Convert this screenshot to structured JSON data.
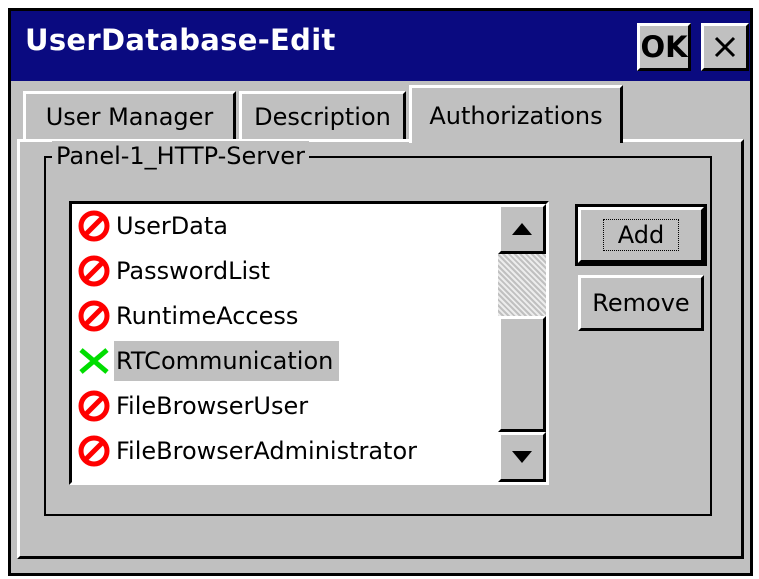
{
  "window": {
    "title": "UserDatabase-Edit",
    "ok_label": "OK",
    "close_icon": "close-icon"
  },
  "tabs": [
    {
      "label": "User Manager",
      "active": false
    },
    {
      "label": "Description",
      "active": false
    },
    {
      "label": "Authorizations",
      "active": true
    }
  ],
  "group": {
    "label": "Panel-1_HTTP-Server"
  },
  "list": {
    "items": [
      {
        "label": "UserData",
        "state": "denied",
        "icon": "prohibited-icon"
      },
      {
        "label": "PasswordList",
        "state": "denied",
        "icon": "prohibited-icon"
      },
      {
        "label": "RuntimeAccess",
        "state": "denied",
        "icon": "prohibited-icon"
      },
      {
        "label": "RTCommunication",
        "state": "granted",
        "icon": "granted-x-icon",
        "selected": true
      },
      {
        "label": "FileBrowserUser",
        "state": "denied",
        "icon": "prohibited-icon"
      },
      {
        "label": "FileBrowserAdministrator",
        "state": "denied",
        "icon": "prohibited-icon"
      }
    ]
  },
  "buttons": {
    "add_label": "Add",
    "remove_label": "Remove"
  },
  "colors": {
    "titlebar": "#0a0a80",
    "face": "#c0c0c0",
    "denied": "#ff0000",
    "granted": "#00dd00"
  }
}
